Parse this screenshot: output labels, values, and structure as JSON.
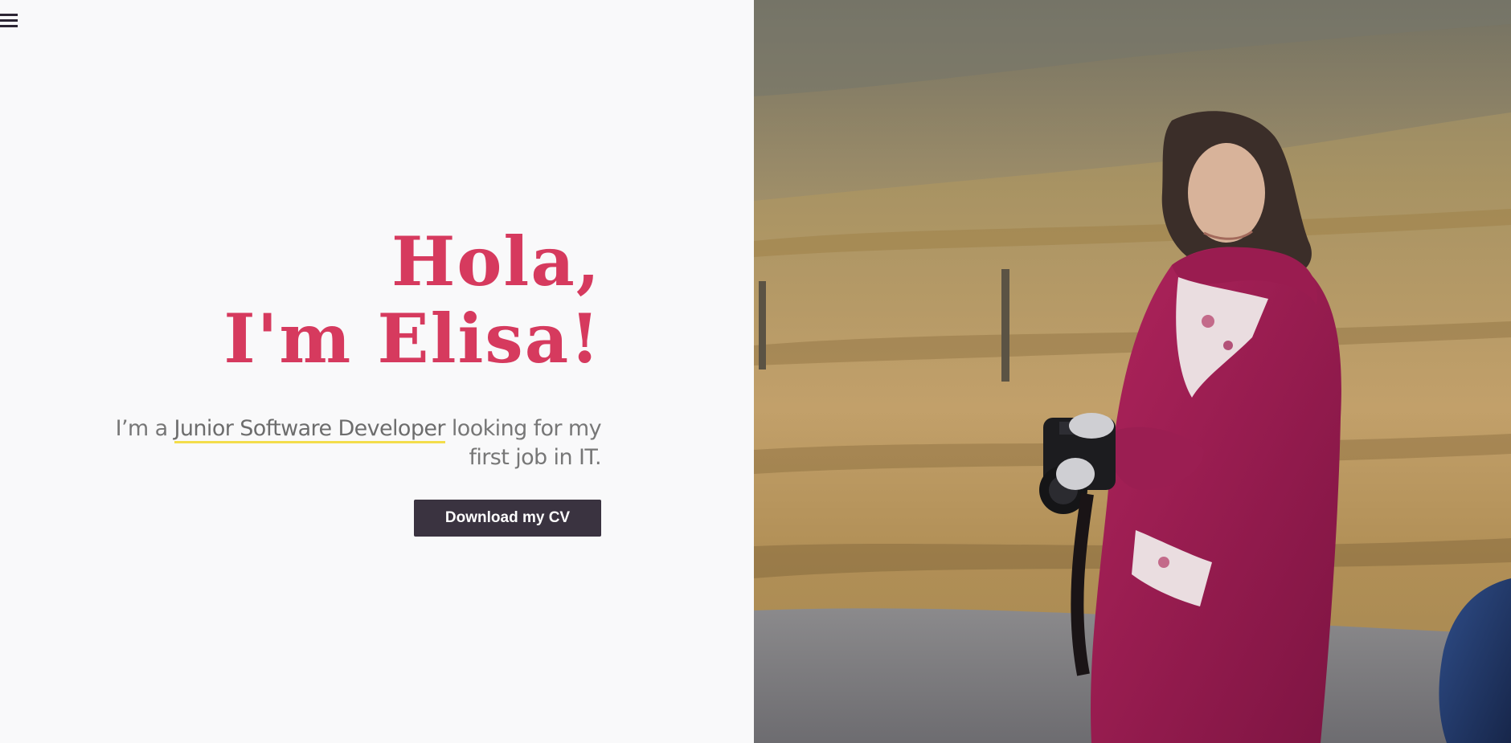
{
  "hero": {
    "title_line1": "Hola,",
    "title_line2": "I'm Elisa!",
    "intro_prefix": "I’m a ",
    "intro_highlight": "Junior Software Developer",
    "intro_suffix": " looking for my first job in IT.",
    "cta_label": "Download my CV"
  },
  "colors": {
    "accent": "#d63a5e",
    "button_bg": "#3a3340",
    "highlight_underline": "#f3dd4b",
    "text_muted": "#777777"
  },
  "icons": {
    "menu": "hamburger-menu-icon"
  },
  "photo": {
    "subject": "woman in magenta jacket holding a Canon camera on a moorland road"
  }
}
